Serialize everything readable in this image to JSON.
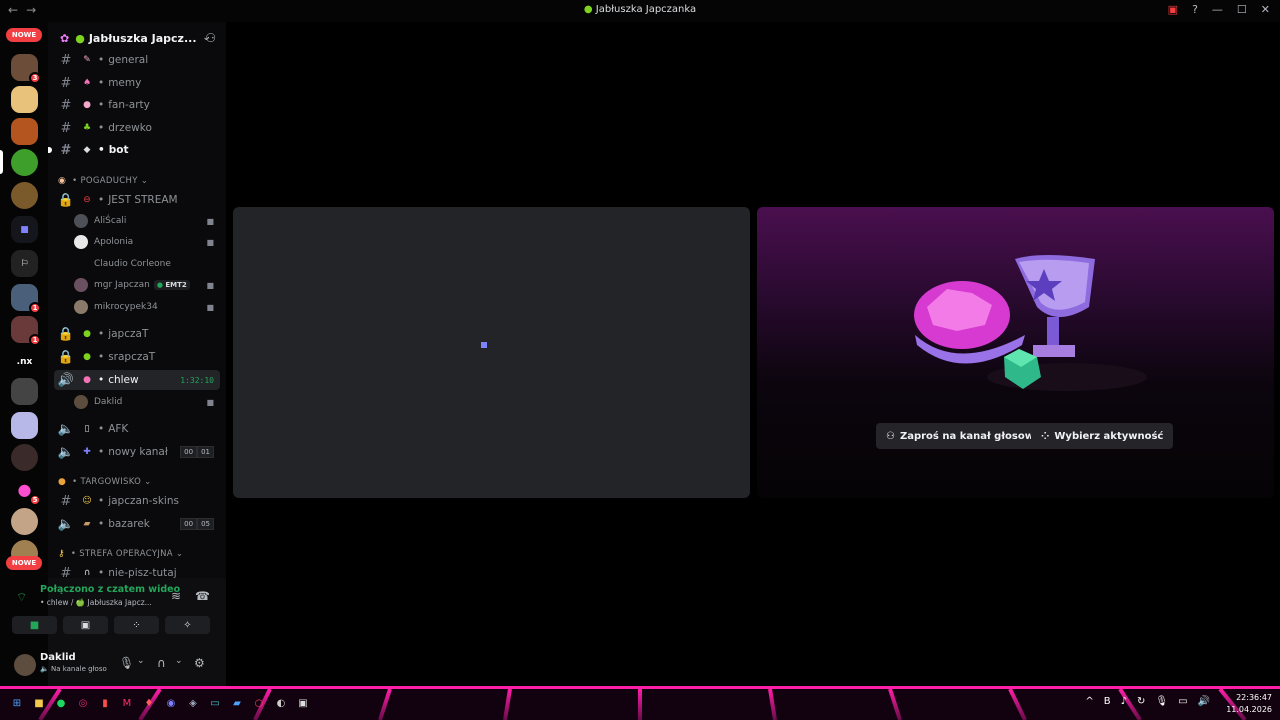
{
  "window": {
    "title": "Jabłuszka Japczanka",
    "nav_back": "←",
    "nav_forward": "→",
    "controls": [
      "—",
      "☐",
      "✕"
    ]
  },
  "rail": {
    "nowe_label": "NOWE",
    "badges": [
      "3",
      "1",
      "1",
      "5"
    ],
    "nx_label": ".nx"
  },
  "server": {
    "name": "Jabłuszka Japcz...",
    "chevron": "⌄"
  },
  "channels": {
    "general": "general",
    "memy": "memy",
    "fan_arty": "fan-arty",
    "drzewko": "drzewko",
    "bot": "bot",
    "cat_pogaduchy": "POGADUCHY",
    "jest_stream": "JEST STREAM",
    "users_stream": [
      "AliŚcali",
      "Apolonia",
      "Claudio Corleone",
      "mgr Japczan",
      "mikrocypek34"
    ],
    "emt_tag": "EMT2",
    "japczat": "japczaT",
    "srapczat": "srapczaT",
    "chlew": "chlew",
    "chlew_timer": "1:32:10",
    "chlew_user": "Daklid",
    "afk": "AFK",
    "nowy_kanal": "nowy kanał",
    "nowy_counter": [
      "00",
      "01"
    ],
    "cat_targowisko": "TARGOWISKO",
    "japczan_skins": "japczan-skins",
    "bazarek": "bazarek",
    "bazarek_counter": [
      "00",
      "05"
    ],
    "cat_strefa": "STREFA OPERACYJNA",
    "nie_pisz": "nie-pisz-tutaj"
  },
  "voice": {
    "status": "Połączono z czatem wideo",
    "location": "• chlew / 🍏 Jabłuszka Japcz..."
  },
  "user": {
    "name": "Daklid",
    "sub": "Na kanale głoso"
  },
  "activity": {
    "invite_label": "Zaproś na kanał głosowy",
    "choose_label": "Wybierz aktywność"
  },
  "clock": {
    "time": "22:36:47",
    "date": "11.04.2026"
  },
  "colors": {
    "green": "#23a55a",
    "red": "#f23f43",
    "accent": "#7f82ff",
    "magenta": "#ff1ea8"
  }
}
